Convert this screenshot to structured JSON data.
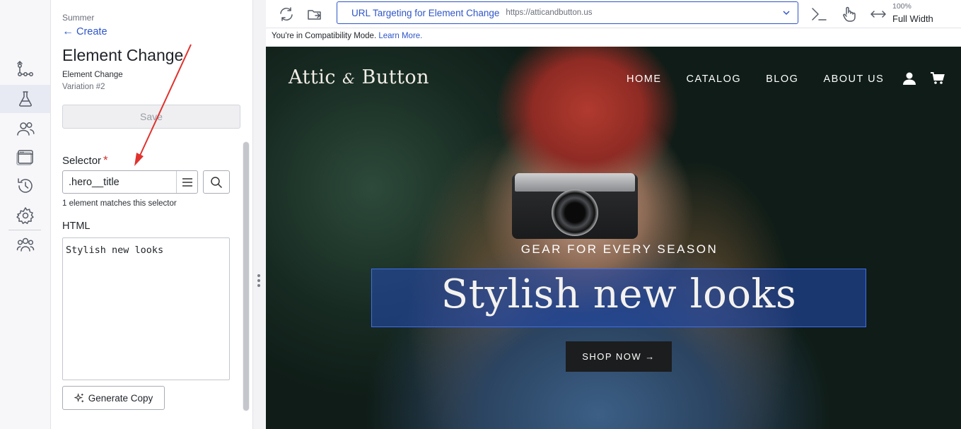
{
  "rail": {
    "items": [
      {
        "name": "flows-icon",
        "active": false
      },
      {
        "name": "experiments-icon",
        "active": true
      },
      {
        "name": "audiences-icon",
        "active": false
      },
      {
        "name": "pages-icon",
        "active": false
      },
      {
        "name": "history-icon",
        "active": false
      },
      {
        "name": "settings-icon",
        "active": false
      },
      {
        "name": "team-icon",
        "active": false
      }
    ]
  },
  "panel": {
    "breadcrumb": "Summer",
    "back_label": "Create",
    "title": "Element Change",
    "subtype": "Element Change",
    "variation": "Variation #2",
    "save_label": "Save",
    "selector_label": "Selector",
    "required_mark": "*",
    "selector_value": ".hero__title",
    "match_text": "1 element matches this selector",
    "html_label": "HTML",
    "html_value": "Stylish new looks",
    "generate_label": "Generate Copy"
  },
  "toolbar": {
    "url_name": "URL Targeting for Element Change",
    "url_value": "https://atticandbutton.us",
    "zoom": "100%",
    "width_label": "Full Width"
  },
  "compat": {
    "text": "You're in Compatibility Mode.",
    "link": "Learn More."
  },
  "preview": {
    "logo_main": "Attic",
    "logo_amp": "&",
    "logo_end": "Button",
    "nav": [
      "HOME",
      "CATALOG",
      "BLOG",
      "ABOUT US"
    ],
    "hero_sub": "GEAR FOR EVERY SEASON",
    "hero_title": "Stylish new looks",
    "shop_label": "SHOP NOW →"
  },
  "colors": {
    "accent": "#2f55c8",
    "required": "#d0312d",
    "annotation": "#e0322d",
    "highlight": "#2348a8"
  }
}
